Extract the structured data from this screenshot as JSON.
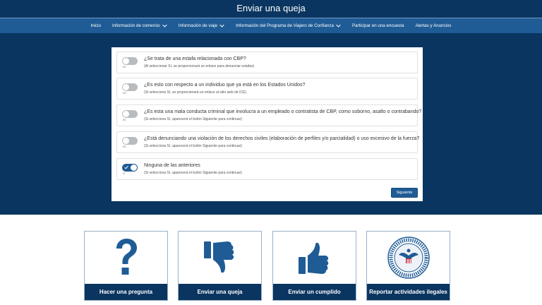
{
  "header": {
    "title": "Enviar una queja"
  },
  "nav": {
    "items": [
      {
        "label": "Inicio",
        "dropdown": false
      },
      {
        "label": "Información de comercio",
        "dropdown": true
      },
      {
        "label": "Información de viaje",
        "dropdown": true
      },
      {
        "label": "Información del Programa de Viajero de Confianza",
        "dropdown": true
      },
      {
        "label": "Participar en una encuesta",
        "dropdown": false
      },
      {
        "label": "Alertas y Anuncios",
        "dropdown": false
      }
    ]
  },
  "questions": [
    {
      "toggle_state": "off",
      "toggle_text": "NO",
      "text": "¿Se trata de una estafa relacionada con CBP?",
      "hint": "(Al seleccionar Sí, se proporcionará un enlace para denunciar estafas)"
    },
    {
      "toggle_state": "off",
      "toggle_text": "NO",
      "text": "¿Es esto con respecto a un individuo que ya está en los Estados Unidos?",
      "hint": "(Si selecciona Sí, se proporcionará un enlace al sitio web de ICE)"
    },
    {
      "toggle_state": "off",
      "toggle_text": "NO",
      "text": "¿Es esta una mala conducta criminal que involucra a un empleado o contratista de CBP, como soborno, asalto o contrabando?",
      "hint": "(Si selecciona Sí, aparecerá el botón Siguiente para continuar)"
    },
    {
      "toggle_state": "off",
      "toggle_text": "NO",
      "text": "¿Está denunciando una violación de los derechos civiles (elaboración de perfiles y/o parcialidad) o uso excesivo de la fuerza?",
      "hint": "(Si selecciona Sí, aparecerá el botón Siguiente para continuar)"
    },
    {
      "toggle_state": "on",
      "toggle_text": "SI",
      "text": "Ninguna de las anteriores",
      "hint": "(Si selecciona Sí, aparecerá el botón Siguiente para continuar)"
    }
  ],
  "next_button": {
    "label": "Siguiente"
  },
  "tiles": [
    {
      "label": "Hacer una pregunta",
      "icon": "question-mark-icon"
    },
    {
      "label": "Enviar una queja",
      "icon": "thumbs-down-icon"
    },
    {
      "label": "Enviar un cumplido",
      "icon": "thumbs-up-icon"
    },
    {
      "label": "Reportar actividades ilegales",
      "icon": "cbp-seal-icon"
    }
  ],
  "colors": {
    "header_bg": "#0a3560",
    "nav_bg": "#1f5c96",
    "accent": "#1f5c96",
    "toggle_off": "#b9bcbf",
    "icon_blue": "#1f5c96"
  }
}
